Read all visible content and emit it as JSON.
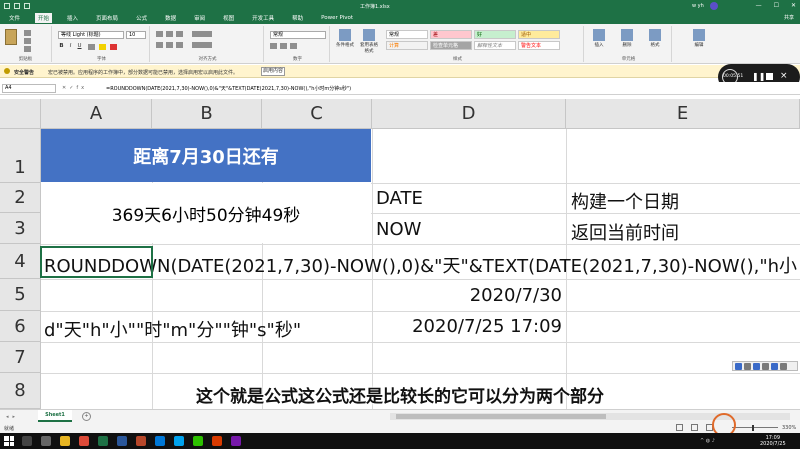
{
  "window": {
    "title": "工作簿1.xlsx",
    "user": "w yh"
  },
  "menu": {
    "tabs": [
      "文件",
      "开始",
      "插入",
      "页面布局",
      "公式",
      "数据",
      "审阅",
      "视图",
      "开发工具",
      "帮助",
      "Power Pivot"
    ],
    "active": "开始",
    "share": "共享"
  },
  "ribbon": {
    "font_name": "等线 Light (标题)",
    "font_size": "10",
    "number_format": "常规",
    "styles": {
      "normal": "常规",
      "bad": "差",
      "good": "好",
      "neutral": "适中",
      "calc": "计算",
      "check": "检查单元格",
      "explain": "解释性文本",
      "warning": "警告文本"
    },
    "buttons": {
      "conditional": "条件格式",
      "table": "套用表格格式",
      "insert": "插入",
      "delete": "删除",
      "format": "格式",
      "edit": "编辑"
    },
    "groups": {
      "clipboard": "剪贴板",
      "font": "字体",
      "alignment": "对齐方式",
      "number": "数字",
      "styles": "样式",
      "cells": "单元格"
    }
  },
  "security_bar": {
    "label": "安全警告",
    "message": "宏已被禁用。应用程序的工作簿中，部分数据可能已禁用，选择启用宏以启用此文件。",
    "button": "启用内容"
  },
  "recorder": {
    "time": "00:05:51"
  },
  "formula_bar": {
    "name_box": "A4",
    "formula": "=ROUNDDOWN(DATE(2021,7,30)-NOW(),0)&\"天\"&TEXT(DATE(2021,7,30)-NOW(),\"h小时m分钟s秒\")"
  },
  "grid": {
    "columns": [
      "A",
      "B",
      "C",
      "D",
      "E"
    ],
    "rows": [
      "1",
      "2",
      "3",
      "4",
      "5",
      "6",
      "7",
      "8"
    ],
    "title_cell": "距离7月30日还有",
    "result_cell": "369天6小时50分钟49秒",
    "d2": "DATE",
    "e2": "构建一个日期",
    "d3": "NOW",
    "e3": "返回当前时间",
    "a4": "ROUNDDOWN(DATE(2021,7,30)-NOW(),0)&\"天\"&TEXT(DATE(2021,7,30)-NOW(),\"h小",
    "d5": "2020/7/30",
    "a6": "d\"天\"h\"小\"\"时\"m\"分\"\"钟\"s\"秒\"",
    "d6": "2020/7/25 17:09"
  },
  "caption": "这个就是公式这公式还是比较长的它可以分为两个部分",
  "sheet_tabs": {
    "active": "Sheet1"
  },
  "status": {
    "ready": "就绪",
    "zoom": "330%"
  },
  "taskbar": {
    "time": "17:09",
    "date": "2020/7/25"
  }
}
